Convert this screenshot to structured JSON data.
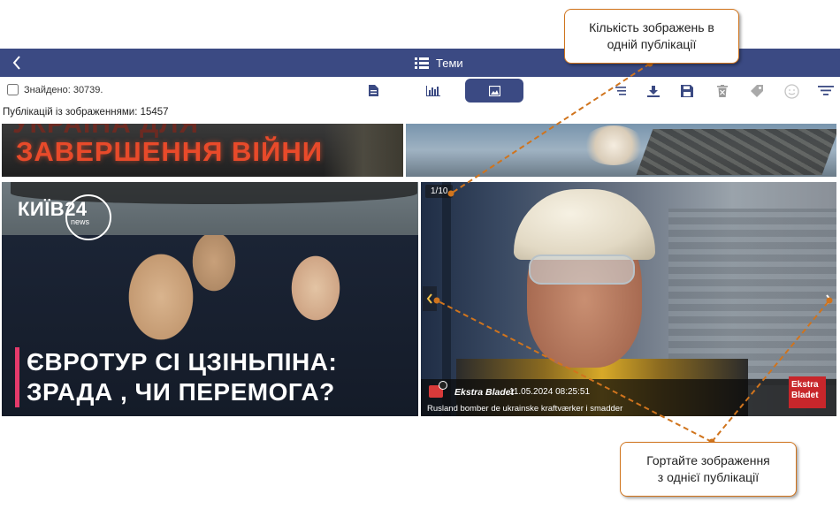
{
  "header": {
    "back_label": "‹",
    "title": "Теми"
  },
  "toolbar": {
    "found_label": "Знайдено: 30739.",
    "views": [
      {
        "name": "document-view",
        "icon": "document-icon"
      },
      {
        "name": "chart-view",
        "icon": "bar-chart-icon"
      },
      {
        "name": "image-view",
        "icon": "image-icon",
        "active": true
      }
    ],
    "tools": [
      "sort-icon",
      "download-icon",
      "save-icon",
      "delete-icon",
      "tag-icon",
      "sentiment-icon",
      "filter-icon"
    ]
  },
  "publications_with_images": "Публікацій із зображеннями: 15457",
  "tiles": {
    "top_left": {
      "faded_text": "УКРАЇНА ДЛЯ",
      "headline": "ЗАВЕРШЕННЯ ВІЙНИ"
    },
    "left": {
      "logo": "КИЇВ24",
      "logo_sub": "news",
      "line1": "ЄВРОТУР СІ ЦЗІНЬПІНА:",
      "line2": "ЗРАДА , ЧИ ПЕРЕМОГА?"
    },
    "right": {
      "counter": "1/10",
      "source": "Ekstra Bladet",
      "date": "11.05.2024 08:25:51",
      "title": "Rusland bomber de ukrainske kraftværker i smadder",
      "watermark_line1": "Ekstra",
      "watermark_line2": "Bladet"
    }
  },
  "callouts": {
    "top": {
      "line1": "Кількість зображень в",
      "line2": "одній публікації"
    },
    "bottom": {
      "line1": "Гортайте зображення",
      "line2": "з однієї публікації"
    }
  },
  "colors": {
    "header_bg": "#3b4a83",
    "callout_border": "#d0741d",
    "accent": "#e53a6b"
  }
}
